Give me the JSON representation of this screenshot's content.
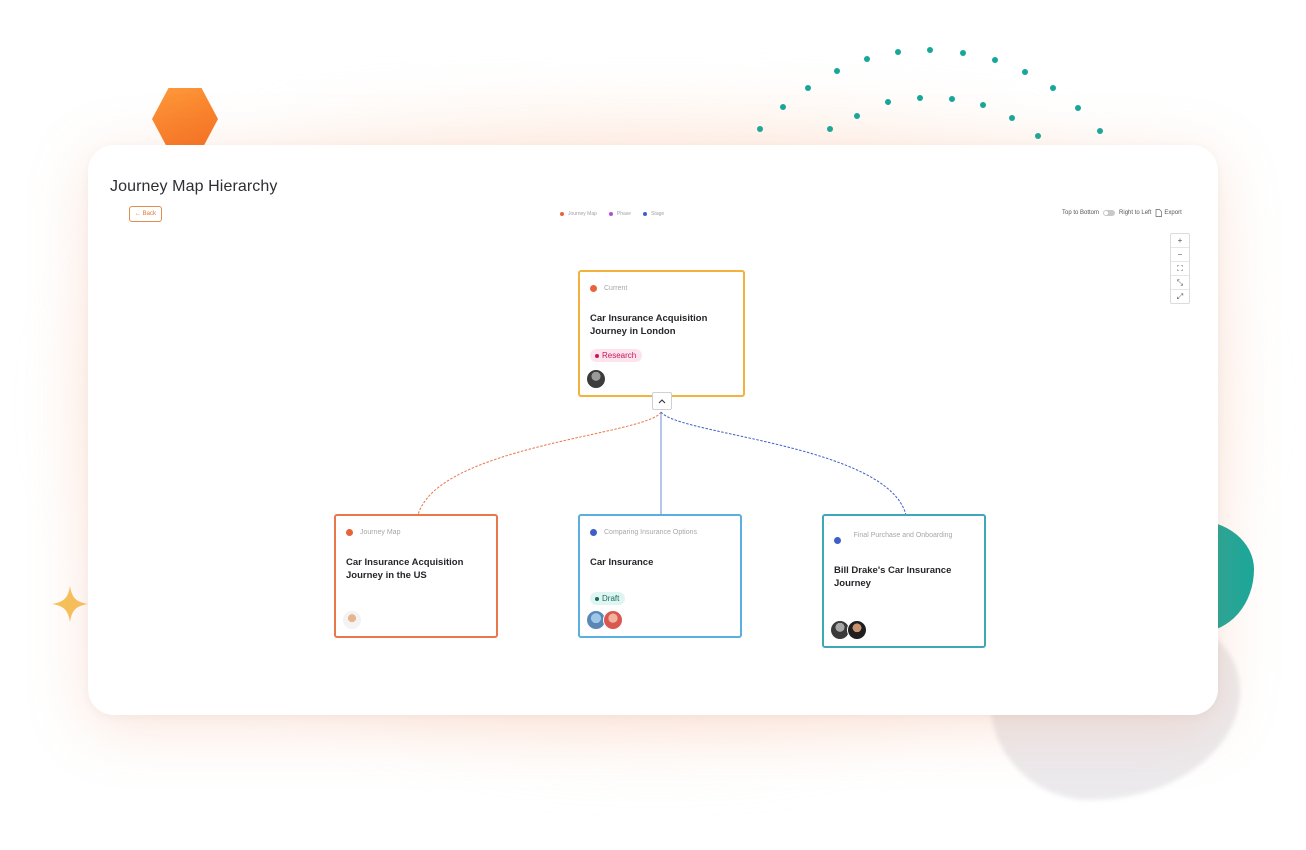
{
  "page": {
    "title": "Journey Map Hierarchy",
    "back_label": "← Back"
  },
  "legend": [
    {
      "label": "Journey Map",
      "color": "#e8623a"
    },
    {
      "label": "Phase",
      "color": "#b34fd1"
    },
    {
      "label": "Stage",
      "color": "#3f5ec9"
    }
  ],
  "toolbar": {
    "orientation_left": "Top to Bottom",
    "orientation_right": "Right to Left",
    "export_label": "Export"
  },
  "zoom_controls": [
    {
      "icon": "plus-icon",
      "glyph": "+"
    },
    {
      "icon": "minus-icon",
      "glyph": "−"
    },
    {
      "icon": "fit-view-icon",
      "glyph": "⛶"
    },
    {
      "icon": "collapse-icon",
      "glyph": "⤡"
    },
    {
      "icon": "expand-icon",
      "glyph": "⤢"
    }
  ],
  "nodes": {
    "root": {
      "type_label": "Current",
      "title": "Car Insurance Acquisition Journey in London",
      "tag": "Research",
      "border_color": "#f2b23b",
      "dot_color": "#e8623a"
    },
    "child_left": {
      "type_label": "Journey Map",
      "title": "Car Insurance Acquisition Journey in the US",
      "border_color": "#e8774a",
      "dot_color": "#e8623a"
    },
    "child_middle": {
      "type_label": "Comparing Insurance Options",
      "title": "Car Insurance",
      "tag": "Draft",
      "border_color": "#5aaee0",
      "dot_color": "#3f5ec9"
    },
    "child_right": {
      "type_label": "Final Purchase and Onboarding",
      "title": "Bill Drake's Car Insurance Journey",
      "border_color": "#3fa8b8",
      "dot_color": "#3f5ec9"
    }
  },
  "colors": {
    "edge_left": "#e8774a",
    "edge_middle": "#6b8ed6",
    "edge_right": "#3f5ec9",
    "research_tag_bg": "#fde4ec",
    "research_tag_text": "#c2185b",
    "draft_tag_bg": "#dff5f1",
    "draft_tag_text": "#1b6b5f"
  }
}
